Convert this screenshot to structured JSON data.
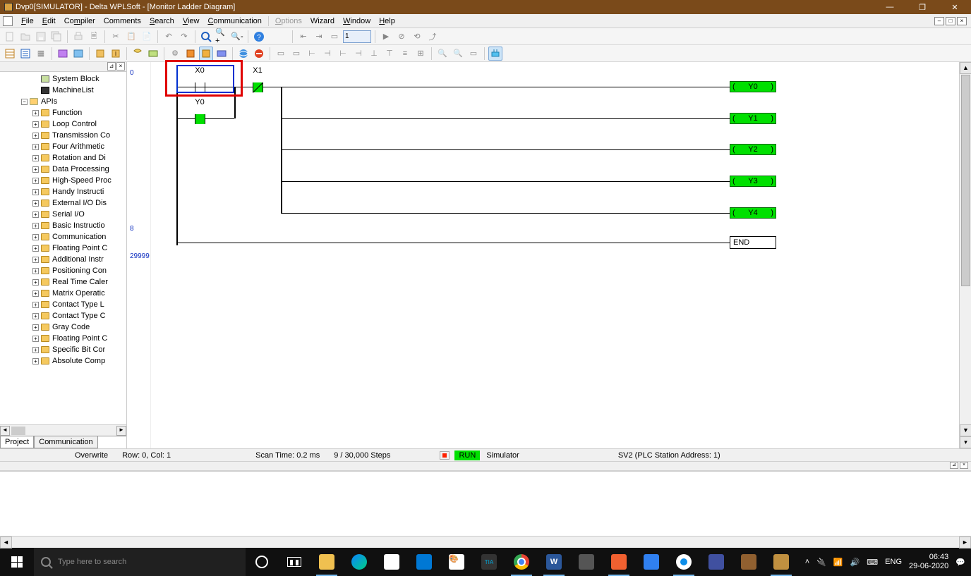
{
  "title": "Dvp0[SIMULATOR]  - Delta WPLSoft - [Monitor Ladder Diagram]",
  "menu": [
    "File",
    "Edit",
    "Compiler",
    "Comments",
    "Search",
    "View",
    "Communication",
    "Options",
    "Wizard",
    "Window",
    "Help"
  ],
  "menu_disabled_index": 7,
  "toolbar2_input": "1",
  "tree": {
    "top": [
      {
        "label": "System Block",
        "icon": "ico-block",
        "indent": 44
      },
      {
        "label": "MachineList",
        "icon": "ico-list",
        "indent": 44
      }
    ],
    "apis_label": "APIs",
    "apis": [
      "Function",
      "Loop Control",
      "Transmission Co",
      "Four Arithmetic",
      "Rotation and Di",
      "Data Processing",
      "High-Speed Proc",
      "Handy Instructi",
      "External I/O Dis",
      "Serial I/O",
      "Basic Instructio",
      "Communication",
      "Floating Point C",
      "Additional Instr",
      "Positioning Con",
      "Real Time Caler",
      "Matrix Operatic",
      "Contact Type L",
      "Contact Type C",
      "Gray Code",
      "Floating Point C",
      "Specific Bit Cor",
      "Absolute Comp"
    ]
  },
  "side_tabs": {
    "a": "Project",
    "b": "Communication"
  },
  "gutter": {
    "a": "0",
    "b": "8",
    "c": "29999"
  },
  "ladder": {
    "x0": "X0",
    "x1": "X1",
    "y0": "Y0",
    "coils": [
      "Y0",
      "Y1",
      "Y2",
      "Y3",
      "Y4"
    ],
    "end": "END"
  },
  "status": {
    "overwrite": "Overwrite",
    "rowcol": "Row: 0, Col: 1",
    "scan": "Scan Time: 0.2 ms",
    "steps": "9 / 30,000 Steps",
    "run": "RUN",
    "sim": "Simulator",
    "plc": "SV2 (PLC Station Address: 1)"
  },
  "taskbar": {
    "search_placeholder": "Type here to search",
    "lang": "ENG",
    "time": "06:43",
    "date": "29-06-2020"
  }
}
